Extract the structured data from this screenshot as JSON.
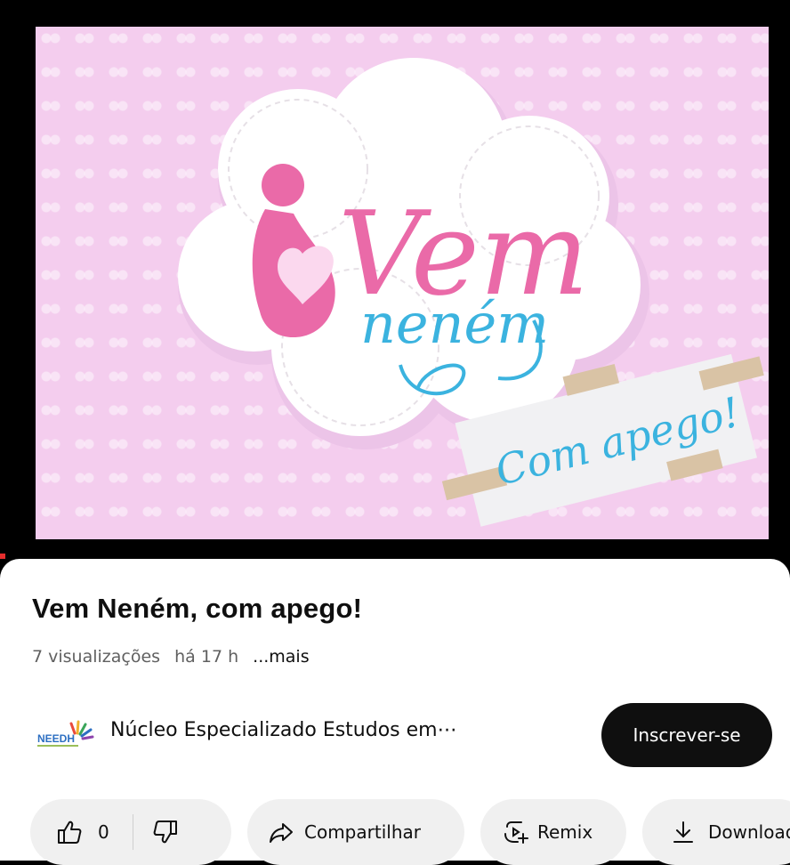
{
  "video": {
    "thumbnail_text_line1": "Vem",
    "thumbnail_text_line2": "neném",
    "thumbnail_note": "Com apego!",
    "colors": {
      "background": "#f4cdee",
      "pink": "#ea6aa8",
      "blue": "#3bb3df"
    }
  },
  "title": "Vem Neném, com apego!",
  "meta": {
    "views": "7 visualizações",
    "time": "há 17 h",
    "more": "...mais"
  },
  "channel": {
    "logo_text": "NEEDH",
    "name": "Núcleo Especializado Estudos em⋯"
  },
  "subscribe_label": "Inscrever-se",
  "actions": {
    "like_count": "0",
    "share_label": "Compartilhar",
    "remix_label": "Remix",
    "download_label": "Download"
  },
  "icons": [
    "thumbs-up-icon",
    "thumbs-down-icon",
    "share-icon",
    "remix-icon",
    "download-icon"
  ]
}
